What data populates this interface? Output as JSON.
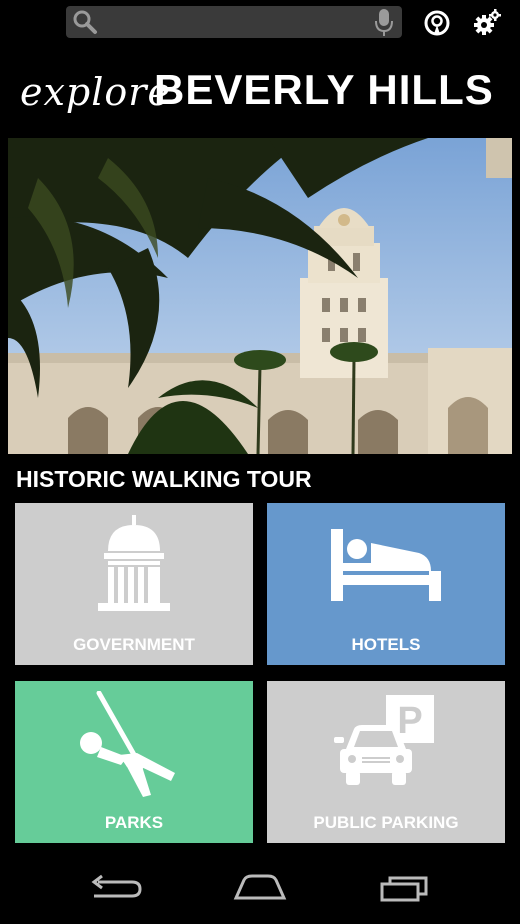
{
  "search": {
    "placeholder": ""
  },
  "header": {
    "logo_script": "explore",
    "logo_main": "BEVERLY HILLS"
  },
  "hero": {
    "image": "city-hall-photo"
  },
  "section": {
    "title": "HISTORIC WALKING TOUR"
  },
  "tiles": [
    {
      "label": "GOVERNMENT",
      "icon": "capitol-building-icon",
      "color": "#cdcdcd"
    },
    {
      "label": "HOTELS",
      "icon": "hotel-bed-icon",
      "color": "#6698cc"
    },
    {
      "label": "PARKS",
      "icon": "swing-icon",
      "color": "#66cc99"
    },
    {
      "label": "PUBLIC PARKING",
      "icon": "parking-car-icon",
      "color": "#cdcdcd"
    }
  ],
  "nav": {
    "back": "back-icon",
    "home": "home-icon",
    "recents": "recents-icon"
  }
}
